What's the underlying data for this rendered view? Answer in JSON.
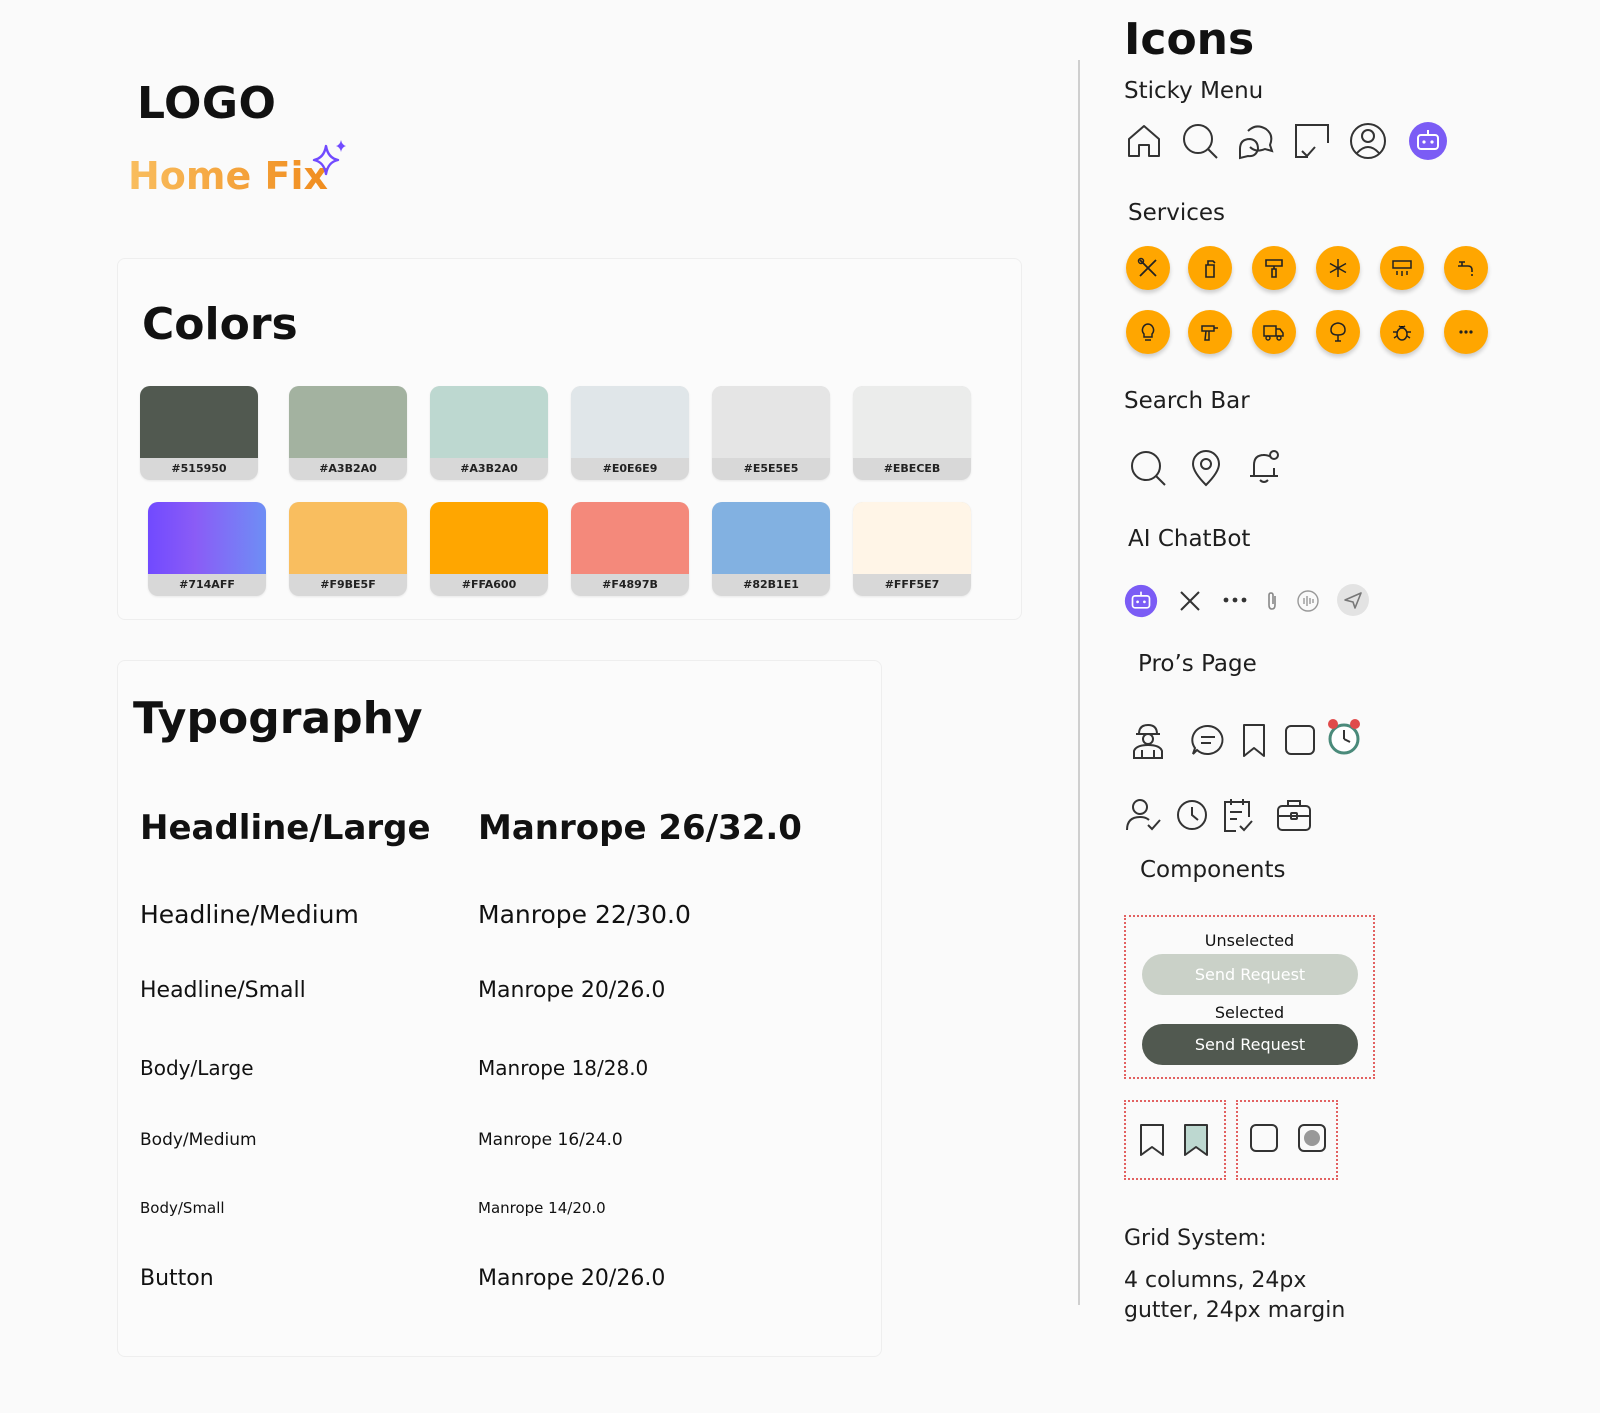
{
  "logo": {
    "heading": "LOGO",
    "brand_name": "Home Fix",
    "sparkle_icon": "sparkle-icon",
    "sparkle_color": "#714AFF"
  },
  "colors": {
    "title": "Colors",
    "swatches": [
      {
        "hex": "#515950",
        "label": "#515950"
      },
      {
        "hex": "#A3B2A0",
        "label": "#A3B2A0"
      },
      {
        "hex": "#BDD8D0",
        "label": "#A3B2A0"
      },
      {
        "hex": "#E0E6E9",
        "label": "#E0E6E9"
      },
      {
        "hex": "#E5E5E5",
        "label": "#E5E5E5"
      },
      {
        "hex": "#EBECEB",
        "label": "#EBECEB"
      },
      {
        "hex": "#714AFF",
        "label": "#714AFF"
      },
      {
        "hex": "#F9BE5F",
        "label": "#F9BE5F"
      },
      {
        "hex": "#FFA600",
        "label": "#FFA600"
      },
      {
        "hex": "#F4897B",
        "label": "#F4897B"
      },
      {
        "hex": "#82B1E1",
        "label": "#82B1E1"
      },
      {
        "hex": "#FFF5E7",
        "label": "#FFF5E7"
      }
    ]
  },
  "typography": {
    "title": "Typography",
    "rows": [
      {
        "name": "Headline/Large",
        "spec": "Manrope 26/32.0"
      },
      {
        "name": "Headline/Medium",
        "spec": "Manrope 22/30.0"
      },
      {
        "name": "Headline/Small",
        "spec": "Manrope 20/26.0"
      },
      {
        "name": "Body/Large",
        "spec": "Manrope 18/28.0"
      },
      {
        "name": "Body/Medium",
        "spec": "Manrope 16/24.0"
      },
      {
        "name": "Body/Small",
        "spec": "Manrope 14/20.0"
      },
      {
        "name": "Button",
        "spec": "Manrope 20/26.0"
      }
    ]
  },
  "icons": {
    "title": "Icons",
    "sticky_menu": {
      "label": "Sticky Menu",
      "items": [
        "home-icon",
        "search-icon",
        "chat-bubbles-icon",
        "task-check-icon",
        "user-circle-icon",
        "robot-icon"
      ]
    },
    "services": {
      "label": "Services",
      "color": "#FFA600",
      "items": [
        "tools-icon",
        "spray-bottle-icon",
        "paint-roller-icon",
        "snowflake-icon",
        "air-conditioner-icon",
        "faucet-icon",
        "light-bulb-icon",
        "drill-icon",
        "moving-truck-icon",
        "tree-icon",
        "bug-icon",
        "more-icon"
      ]
    },
    "search_bar": {
      "label": "Search Bar",
      "items": [
        "search-icon",
        "location-pin-icon",
        "notification-bell-icon"
      ]
    },
    "ai_chatbot": {
      "label": "AI ChatBot",
      "items": [
        "robot-icon",
        "close-icon",
        "more-horizontal-icon",
        "attachment-icon",
        "voice-icon",
        "send-icon"
      ]
    },
    "pros_page": {
      "label": "Pro’s Page",
      "row1": [
        "worker-icon",
        "message-icon",
        "bookmark-icon",
        "checkbox-icon",
        "alarm-clock-icon"
      ],
      "row2": [
        "user-check-icon",
        "clock-icon",
        "checklist-icon",
        "briefcase-icon"
      ]
    },
    "components": {
      "label": "Components",
      "unselected_label": "Unselected",
      "selected_label": "Selected",
      "button_text": "Send Request",
      "unselected_color": "#CAD1C8",
      "selected_color": "#515950"
    },
    "grid": {
      "label": "Grid System:",
      "line1": "4 columns, 24px",
      "line2": "gutter, 24px margin"
    }
  }
}
